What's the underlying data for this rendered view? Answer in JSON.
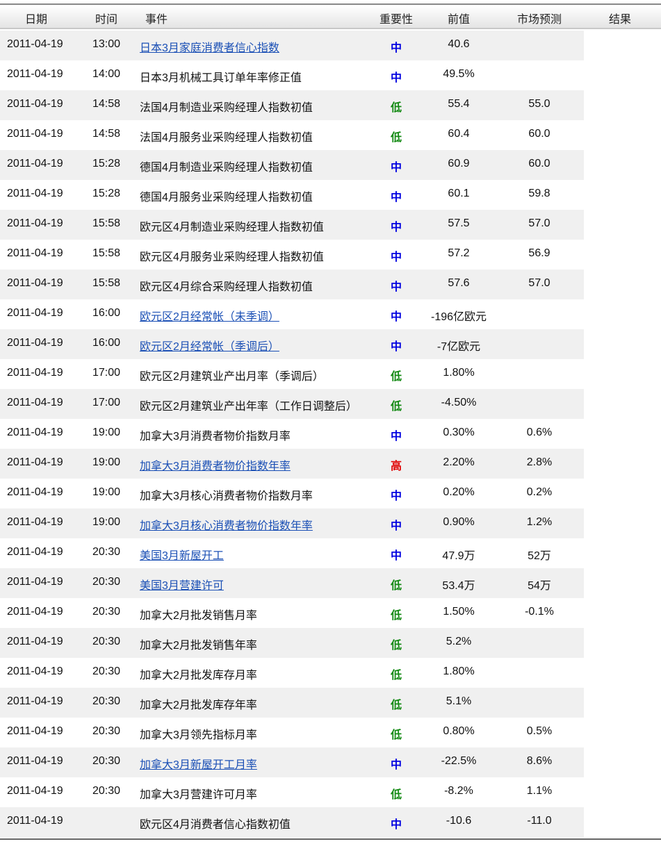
{
  "header": {
    "date": "日期",
    "time": "时间",
    "event": "事件",
    "importance": "重要性",
    "previous": "前值",
    "forecast": "市场预测",
    "result": "结果"
  },
  "colors": {
    "高": "#e00000",
    "中": "#0000e0",
    "低": "#138a13"
  },
  "rows": [
    {
      "date": "2011-04-19",
      "time": "13:00",
      "event": "日本3月家庭消费者信心指数",
      "link": true,
      "importance": "中",
      "previous": "40.6",
      "forecast": "",
      "result": ""
    },
    {
      "date": "2011-04-19",
      "time": "14:00",
      "event": "日本3月机械工具订单年率修正值",
      "link": false,
      "importance": "中",
      "previous": "49.5%",
      "forecast": "",
      "result": ""
    },
    {
      "date": "2011-04-19",
      "time": "14:58",
      "event": "法国4月制造业采购经理人指数初值",
      "link": false,
      "importance": "低",
      "previous": "55.4",
      "forecast": "55.0",
      "result": ""
    },
    {
      "date": "2011-04-19",
      "time": "14:58",
      "event": "法国4月服务业采购经理人指数初值",
      "link": false,
      "importance": "低",
      "previous": "60.4",
      "forecast": "60.0",
      "result": ""
    },
    {
      "date": "2011-04-19",
      "time": "15:28",
      "event": "德国4月制造业采购经理人指数初值",
      "link": false,
      "importance": "中",
      "previous": "60.9",
      "forecast": "60.0",
      "result": ""
    },
    {
      "date": "2011-04-19",
      "time": "15:28",
      "event": "德国4月服务业采购经理人指数初值",
      "link": false,
      "importance": "中",
      "previous": "60.1",
      "forecast": "59.8",
      "result": ""
    },
    {
      "date": "2011-04-19",
      "time": "15:58",
      "event": "欧元区4月制造业采购经理人指数初值",
      "link": false,
      "importance": "中",
      "previous": "57.5",
      "forecast": "57.0",
      "result": ""
    },
    {
      "date": "2011-04-19",
      "time": "15:58",
      "event": "欧元区4月服务业采购经理人指数初值",
      "link": false,
      "importance": "中",
      "previous": "57.2",
      "forecast": "56.9",
      "result": ""
    },
    {
      "date": "2011-04-19",
      "time": "15:58",
      "event": "欧元区4月综合采购经理人指数初值",
      "link": false,
      "importance": "中",
      "previous": "57.6",
      "forecast": "57.0",
      "result": ""
    },
    {
      "date": "2011-04-19",
      "time": "16:00",
      "event": "欧元区2月经常帐（未季调）",
      "link": true,
      "importance": "中",
      "previous": "-196亿欧元",
      "forecast": "",
      "result": ""
    },
    {
      "date": "2011-04-19",
      "time": "16:00",
      "event": "欧元区2月经常帐（季调后）",
      "link": true,
      "importance": "中",
      "previous": "-7亿欧元",
      "forecast": "",
      "result": ""
    },
    {
      "date": "2011-04-19",
      "time": "17:00",
      "event": "欧元区2月建筑业产出月率（季调后）",
      "link": false,
      "importance": "低",
      "previous": "1.80%",
      "forecast": "",
      "result": ""
    },
    {
      "date": "2011-04-19",
      "time": "17:00",
      "event": "欧元区2月建筑业产出年率（工作日调整后）",
      "link": false,
      "importance": "低",
      "previous": "-4.50%",
      "forecast": "",
      "result": ""
    },
    {
      "date": "2011-04-19",
      "time": "19:00",
      "event": "加拿大3月消费者物价指数月率",
      "link": false,
      "importance": "中",
      "previous": "0.30%",
      "forecast": "0.6%",
      "result": ""
    },
    {
      "date": "2011-04-19",
      "time": "19:00",
      "event": "加拿大3月消费者物价指数年率",
      "link": true,
      "importance": "高",
      "previous": "2.20%",
      "forecast": "2.8%",
      "result": ""
    },
    {
      "date": "2011-04-19",
      "time": "19:00",
      "event": "加拿大3月核心消费者物价指数月率",
      "link": false,
      "importance": "中",
      "previous": "0.20%",
      "forecast": "0.2%",
      "result": ""
    },
    {
      "date": "2011-04-19",
      "time": "19:00",
      "event": "加拿大3月核心消费者物价指数年率",
      "link": true,
      "importance": "中",
      "previous": "0.90%",
      "forecast": "1.2%",
      "result": ""
    },
    {
      "date": "2011-04-19",
      "time": "20:30",
      "event": "美国3月新屋开工",
      "link": true,
      "importance": "中",
      "previous": "47.9万",
      "forecast": "52万",
      "result": ""
    },
    {
      "date": "2011-04-19",
      "time": "20:30",
      "event": "美国3月营建许可",
      "link": true,
      "importance": "低",
      "previous": "53.4万",
      "forecast": "54万",
      "result": ""
    },
    {
      "date": "2011-04-19",
      "time": "20:30",
      "event": "加拿大2月批发销售月率",
      "link": false,
      "importance": "低",
      "previous": "1.50%",
      "forecast": "-0.1%",
      "result": ""
    },
    {
      "date": "2011-04-19",
      "time": "20:30",
      "event": "加拿大2月批发销售年率",
      "link": false,
      "importance": "低",
      "previous": "5.2%",
      "forecast": "",
      "result": ""
    },
    {
      "date": "2011-04-19",
      "time": "20:30",
      "event": "加拿大2月批发库存月率",
      "link": false,
      "importance": "低",
      "previous": "1.80%",
      "forecast": "",
      "result": ""
    },
    {
      "date": "2011-04-19",
      "time": "20:30",
      "event": "加拿大2月批发库存年率",
      "link": false,
      "importance": "低",
      "previous": "5.1%",
      "forecast": "",
      "result": ""
    },
    {
      "date": "2011-04-19",
      "time": "20:30",
      "event": "加拿大3月领先指标月率",
      "link": false,
      "importance": "低",
      "previous": "0.80%",
      "forecast": "0.5%",
      "result": ""
    },
    {
      "date": "2011-04-19",
      "time": "20:30",
      "event": "加拿大3月新屋开工月率",
      "link": true,
      "importance": "中",
      "previous": "-22.5%",
      "forecast": "8.6%",
      "result": ""
    },
    {
      "date": "2011-04-19",
      "time": "20:30",
      "event": "加拿大3月营建许可月率",
      "link": false,
      "importance": "低",
      "previous": "-8.2%",
      "forecast": "1.1%",
      "result": ""
    },
    {
      "date": "2011-04-19",
      "time": "",
      "event": "欧元区4月消费者信心指数初值",
      "link": false,
      "importance": "中",
      "previous": "-10.6",
      "forecast": "-11.0",
      "result": ""
    }
  ]
}
